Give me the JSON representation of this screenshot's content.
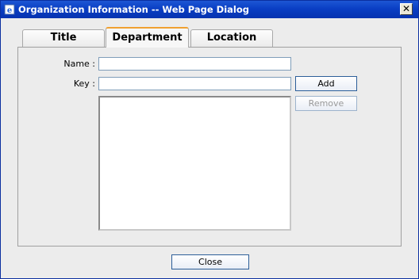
{
  "window": {
    "title": "Organization Information -- Web Page Dialog",
    "close_glyph": "✕"
  },
  "tabs": [
    {
      "label": "Title",
      "active": false
    },
    {
      "label": "Department",
      "active": true
    },
    {
      "label": "Location",
      "active": false
    }
  ],
  "form": {
    "name_label": "Name :",
    "name_value": "",
    "key_label": "Key :",
    "key_value": "",
    "add_label": "Add",
    "remove_label": "Remove",
    "items": []
  },
  "footer": {
    "close_label": "Close"
  }
}
